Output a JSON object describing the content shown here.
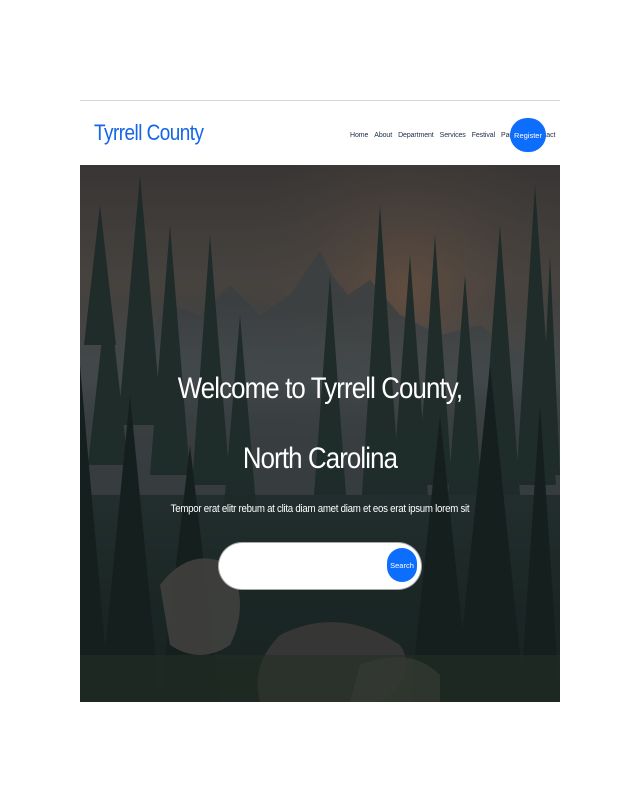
{
  "site": {
    "brand": "Tyrrell County"
  },
  "nav": {
    "items": [
      {
        "label": "Home"
      },
      {
        "label": "About"
      },
      {
        "label": "Department"
      },
      {
        "label": "Services"
      },
      {
        "label": "Festival"
      },
      {
        "label": "Pages",
        "dropdown": true
      },
      {
        "label": "Contact"
      }
    ],
    "register_label": "Register"
  },
  "hero": {
    "title_line1": "Welcome to Tyrrell County,",
    "title_line2": "North Carolina",
    "subtitle": "Tempor erat elitr rebum at clita diam amet diam et eos erat ipsum lorem sit",
    "background_image": "forest-mountain-landscape"
  },
  "search": {
    "placeholder": "",
    "value": "",
    "button_label": "Search"
  },
  "colors": {
    "brand": "#1565e8",
    "primary_button": "#0d6efd",
    "nav_text": "#1c2b4a"
  }
}
